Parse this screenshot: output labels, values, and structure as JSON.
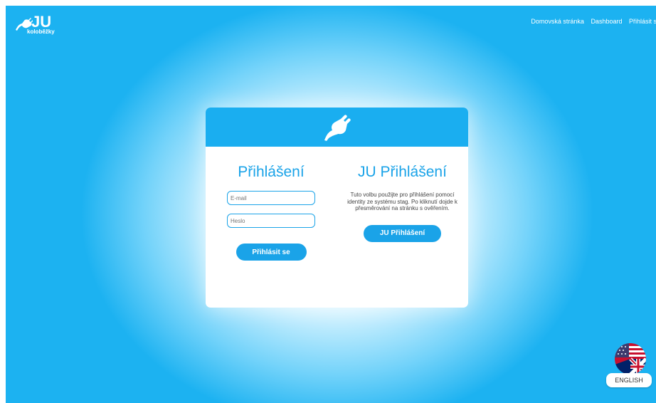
{
  "logo": {
    "text": "JU",
    "subtitle": "koloběžky"
  },
  "nav": {
    "items": [
      "Domovská stránka",
      "Dashboard",
      "Přihlásit se"
    ]
  },
  "login": {
    "title": "Přihlášení",
    "email_placeholder": "E-mail",
    "password_placeholder": "Heslo",
    "button": "Přihlásit se"
  },
  "ju_login": {
    "title": "JU Přihlášení",
    "description": "Tuto volbu použijte pro přihlášení pomocí identity ze systému stag. Po kliknutí dojde k přesměrování na stránku s ověřením.",
    "button": "JU Přihlášení"
  },
  "language": {
    "label": "ENGLISH"
  },
  "colors": {
    "accent": "#1aa3e8",
    "background": "#1cb2f1"
  },
  "icons": [
    "plug-icon",
    "flag-icon"
  ]
}
